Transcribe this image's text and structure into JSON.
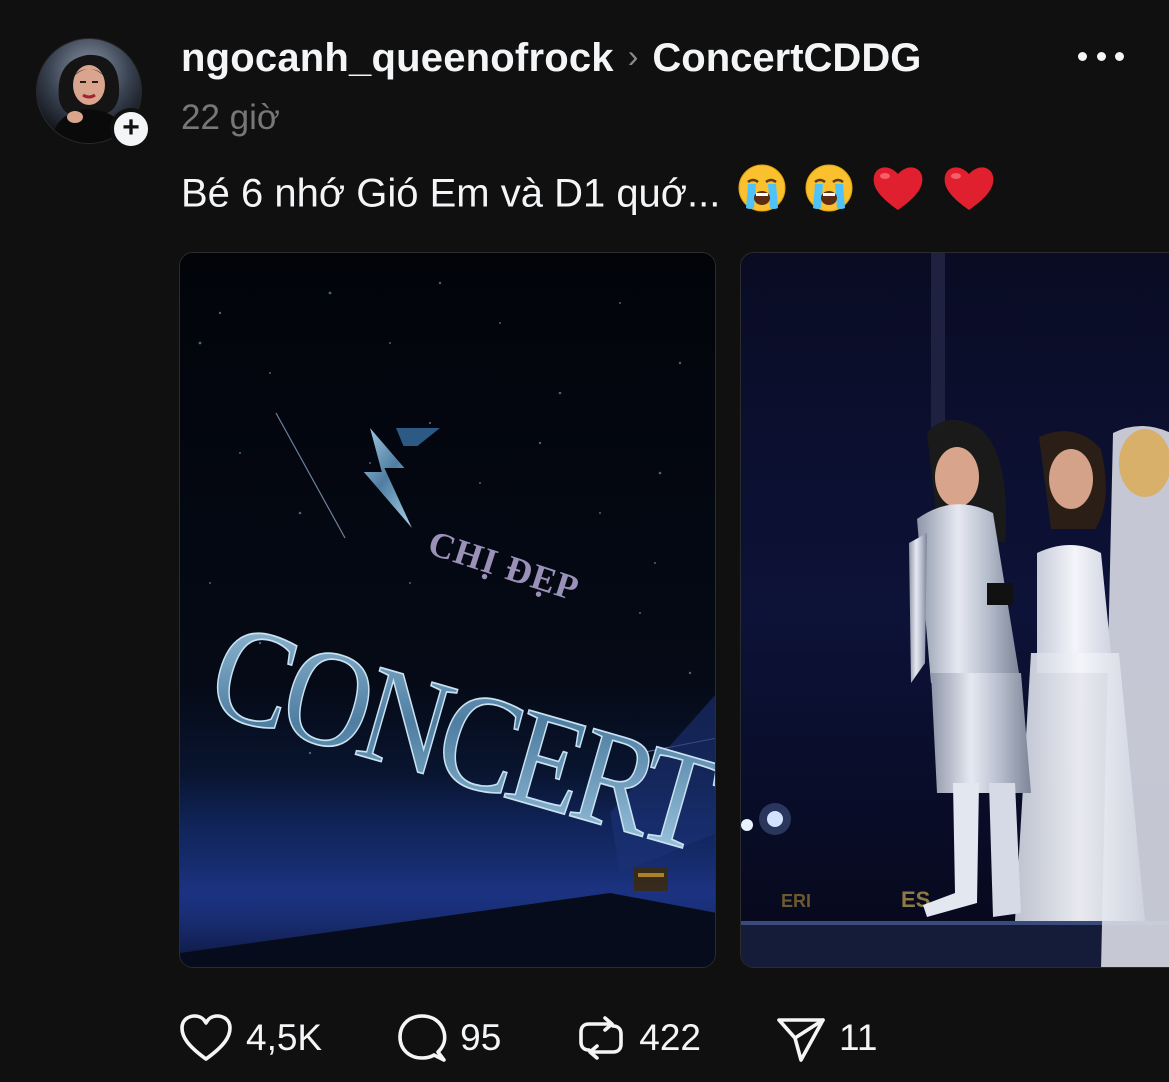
{
  "post": {
    "username": "ngocanh_queenofrock",
    "separator": "›",
    "topic": "ConcertCDDG",
    "timestamp": "22 giờ",
    "caption_text": "Bé 6 nhớ Gió Em và D1 quớ...",
    "caption_emojis": [
      "loudly-crying-face",
      "loudly-crying-face",
      "red-heart",
      "red-heart"
    ]
  },
  "follow_badge": "+",
  "media": [
    {
      "kind": "image",
      "logo_prefix": "CHỊ ĐẸP",
      "logo_text": "CONCERT"
    },
    {
      "kind": "image",
      "banner_letters": [
        "ERI",
        "ES"
      ]
    }
  ],
  "actions": {
    "likes": "4,5K",
    "replies": "95",
    "reposts": "422",
    "shares": "11"
  },
  "icons": {
    "like": "heart-icon",
    "reply": "speech-bubble-icon",
    "repost": "repost-icon",
    "share": "paper-plane-icon",
    "more": "ellipsis-icon"
  },
  "colors": {
    "background": "#101010",
    "text_primary": "#f3f5f7",
    "text_secondary": "#777777"
  }
}
